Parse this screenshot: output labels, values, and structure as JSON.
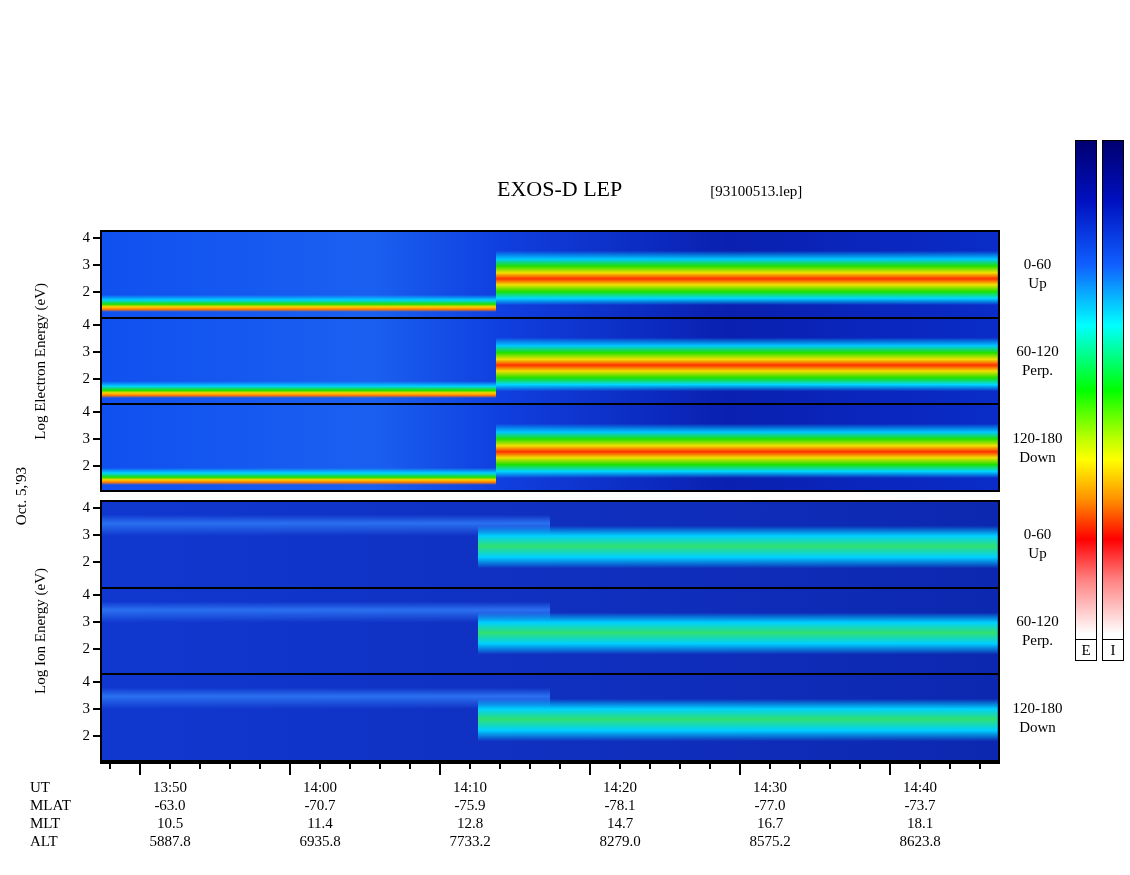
{
  "title": "EXOS-D LEP",
  "file": "[93100513.lep]",
  "date": "Oct. 5,'93",
  "groups": [
    {
      "kind": "electron",
      "axis_title": "Log Electron Energy (eV)",
      "panels": [
        {
          "yticks": [
            "4",
            "3",
            "2"
          ],
          "pitch_range": "0-60",
          "direction": "Up"
        },
        {
          "yticks": [
            "4",
            "3",
            "2"
          ],
          "pitch_range": "60-120",
          "direction": "Perp."
        },
        {
          "yticks": [
            "4",
            "3",
            "2"
          ],
          "pitch_range": "120-180",
          "direction": "Down"
        }
      ]
    },
    {
      "kind": "ion",
      "axis_title": "Log Ion Energy (eV)",
      "panels": [
        {
          "yticks": [
            "4",
            "3",
            "2"
          ],
          "pitch_range": "0-60",
          "direction": "Up"
        },
        {
          "yticks": [
            "4",
            "3",
            "2"
          ],
          "pitch_range": "60-120",
          "direction": "Perp."
        },
        {
          "yticks": [
            "4",
            "3",
            "2"
          ],
          "pitch_range": "120-180",
          "direction": "Down"
        }
      ]
    }
  ],
  "colorbars": [
    {
      "label": "E"
    },
    {
      "label": "I"
    }
  ],
  "ephemeris": [
    {
      "label": "UT",
      "values": [
        "13:50",
        "14:00",
        "14:10",
        "14:20",
        "14:30",
        "14:40"
      ]
    },
    {
      "label": "MLAT",
      "values": [
        "-63.0",
        "-70.7",
        "-75.9",
        "-78.1",
        "-77.0",
        "-73.7"
      ]
    },
    {
      "label": "MLT",
      "values": [
        "10.5",
        "11.4",
        "12.8",
        "14.7",
        "16.7",
        "18.1"
      ]
    },
    {
      "label": "ALT",
      "values": [
        "5887.8",
        "6935.8",
        "7733.2",
        "8279.0",
        "8575.2",
        "8623.8"
      ]
    }
  ]
}
